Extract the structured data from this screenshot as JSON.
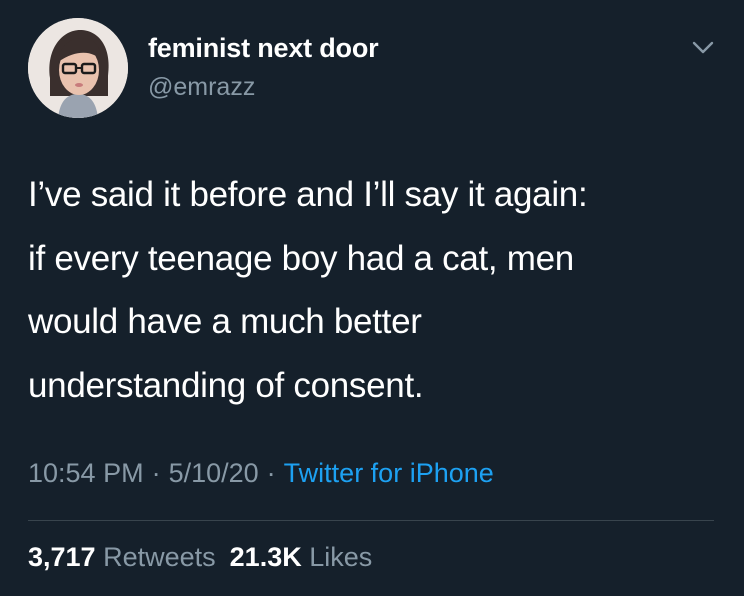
{
  "user": {
    "display_name": "feminist next door",
    "handle": "@emrazz"
  },
  "tweet": {
    "lines": [
      "I’ve said it before and I’ll say it again:",
      "if every teenage boy had a cat, men",
      "would have a much better",
      "understanding of consent."
    ],
    "time": "10:54 PM",
    "date": "5/10/20",
    "separator": "·",
    "source": "Twitter for iPhone"
  },
  "stats": {
    "retweets_count": "3,717",
    "retweets_label": "Retweets",
    "likes_count": "21.3K",
    "likes_label": "Likes"
  },
  "icons": {
    "menu": "chevron-down-icon",
    "avatar": "avatar"
  },
  "colors": {
    "background": "#15202b",
    "primary_text": "#ffffff",
    "secondary_text": "#8899a6",
    "link": "#1da1f2",
    "divider": "#38444d"
  }
}
